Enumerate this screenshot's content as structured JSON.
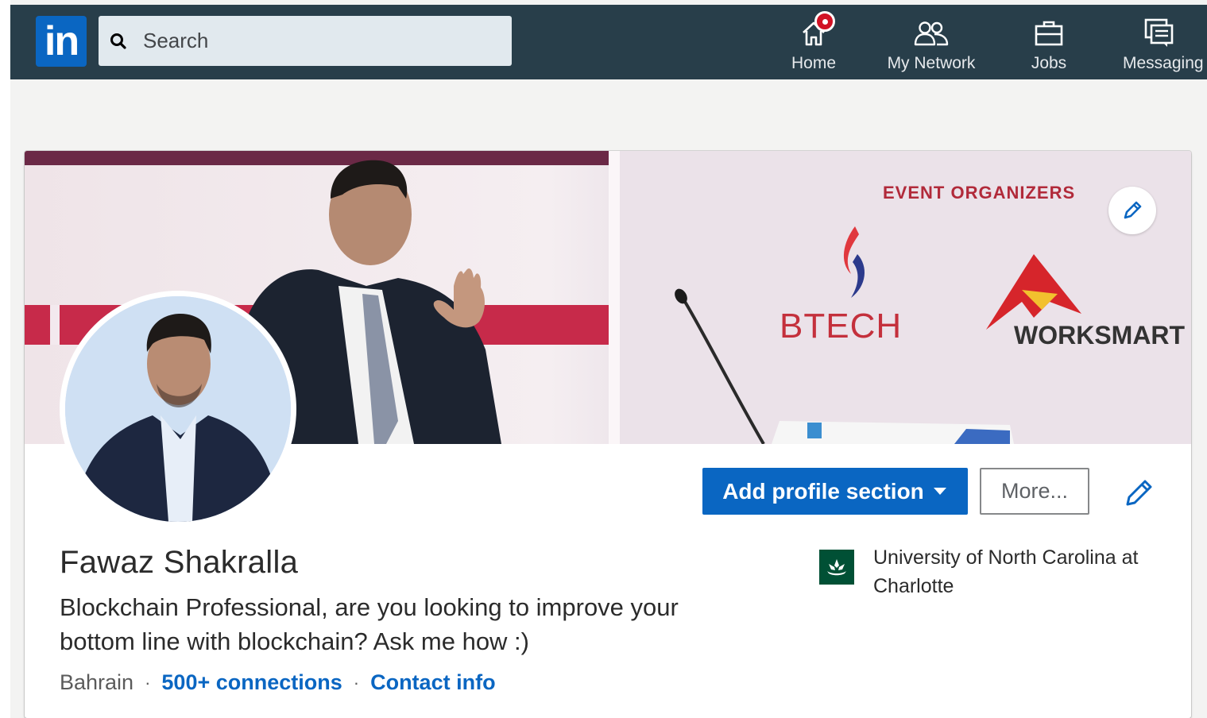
{
  "nav": {
    "logo_text": "in",
    "search_placeholder": "Search",
    "items": [
      {
        "label": "Home",
        "icon": "home-icon",
        "has_notification": true
      },
      {
        "label": "My Network",
        "icon": "people-icon"
      },
      {
        "label": "Jobs",
        "icon": "briefcase-icon"
      },
      {
        "label": "Messaging",
        "icon": "messaging-icon"
      }
    ]
  },
  "banner": {
    "heading": "EVENT ORGANIZERS",
    "sponsors": [
      "BTECH",
      "WORKSMART"
    ]
  },
  "profile": {
    "name": "Fawaz Shakralla",
    "headline": "Blockchain Professional, are you looking to improve your bottom line with blockchain? Ask me how :)",
    "location": "Bahrain",
    "connections": "500+ connections",
    "contact": "Contact info",
    "education": "University of North Carolina at Charlotte"
  },
  "actions": {
    "add_section": "Add profile section",
    "more": "More..."
  },
  "colors": {
    "nav_bg": "#283e4a",
    "brand_blue": "#0a66c2",
    "school_green": "#005035",
    "notification_red": "#d11124"
  }
}
